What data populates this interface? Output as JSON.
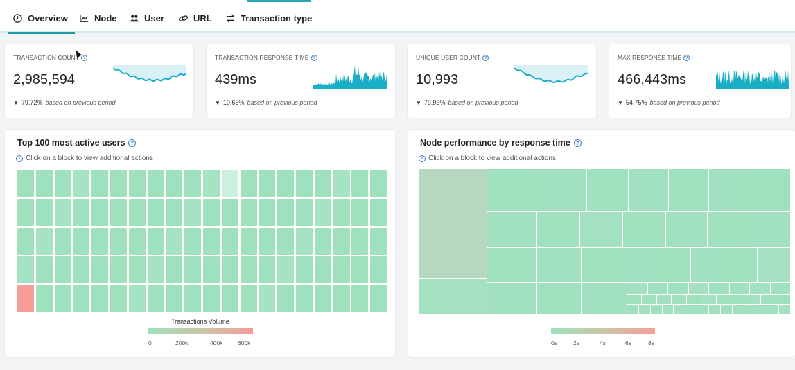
{
  "tabs": [
    {
      "label": "Overview",
      "icon": "clock-icon",
      "active": true
    },
    {
      "label": "Node",
      "icon": "chart-icon",
      "active": false
    },
    {
      "label": "User",
      "icon": "users-icon",
      "active": false
    },
    {
      "label": "URL",
      "icon": "link-icon",
      "active": false
    },
    {
      "label": "Transaction type",
      "icon": "swap-icon",
      "active": false
    }
  ],
  "kpis": [
    {
      "label": "TRANSACTION COUNT",
      "value": "2,985,594",
      "delta": "79.72%",
      "note": "based on previous period",
      "trend": "down"
    },
    {
      "label": "TRANSACTION RESPONSE TIME",
      "value": "439ms",
      "delta": "10.65%",
      "note": "based on previous period",
      "trend": "down"
    },
    {
      "label": "UNIQUE USER COUNT",
      "value": "10,993",
      "delta": "79.93%",
      "note": "based on previous period",
      "trend": "down"
    },
    {
      "label": "MAX RESPONSE TIME",
      "value": "466,443ms",
      "delta": "54.75%",
      "note": "based on previous period",
      "trend": "down"
    }
  ],
  "users_panel": {
    "title": "Top 100 most active users",
    "hint": "Click on a block to view additional actions",
    "legend_title": "Transactions Volume",
    "legend_ticks": [
      "0",
      "200k",
      "400k",
      "600k"
    ]
  },
  "nodes_panel": {
    "title": "Node performance by response time",
    "hint": "Click on a block to view additional actions",
    "legend_ticks": [
      "0s",
      "2s",
      "4s",
      "6s",
      "8s"
    ]
  },
  "colors": {
    "accent": "#1e9aa8",
    "spark": "#18aec6",
    "cell_low": "#9fe0bd",
    "cell_high": "#f59d96"
  }
}
